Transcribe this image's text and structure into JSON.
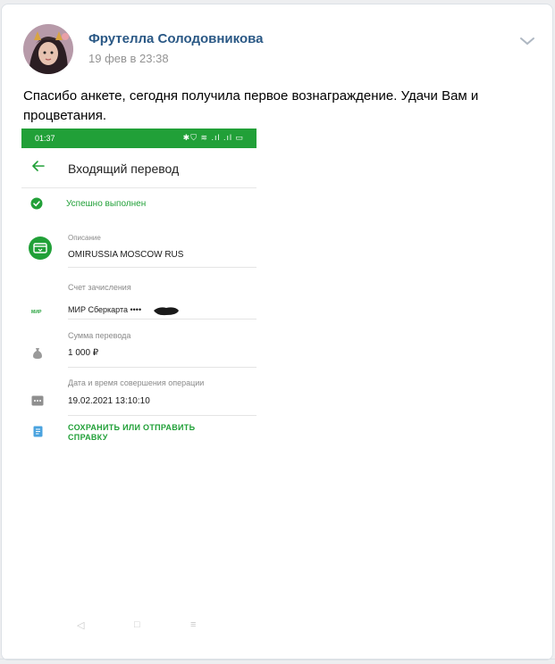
{
  "post": {
    "author": "Фрутелла Солодовникова",
    "date": "19 фев в 23:38",
    "text": "Спасибо анкете, сегодня получила первое вознаграждение. Удачи Вам и процветания."
  },
  "screenshot": {
    "status_time": "01:37",
    "status_icons": "✱⛉ ≋ .ıl .ıl ▭",
    "title": "Входящий перевод",
    "status": "Успешно выполнен",
    "description_label": "Описание",
    "description_value": "OMIRUSSIA MOSCOW RUS",
    "account_label": "Счет зачисления",
    "account_value": "МИР Сберкарта ••••",
    "mir_logo": "МИР",
    "amount_label": "Сумма перевода",
    "amount_value": "1 000 ₽",
    "datetime_label": "Дата и время совершения операции",
    "datetime_value": "19.02.2021 13:10:10",
    "action": "СОХРАНИТЬ ИЛИ ОТПРАВИТЬ СПРАВКУ",
    "nav_back": "◁",
    "nav_home": "□",
    "nav_menu": "≡"
  },
  "colors": {
    "link": "#2a5885",
    "sber_green": "#21a038"
  }
}
